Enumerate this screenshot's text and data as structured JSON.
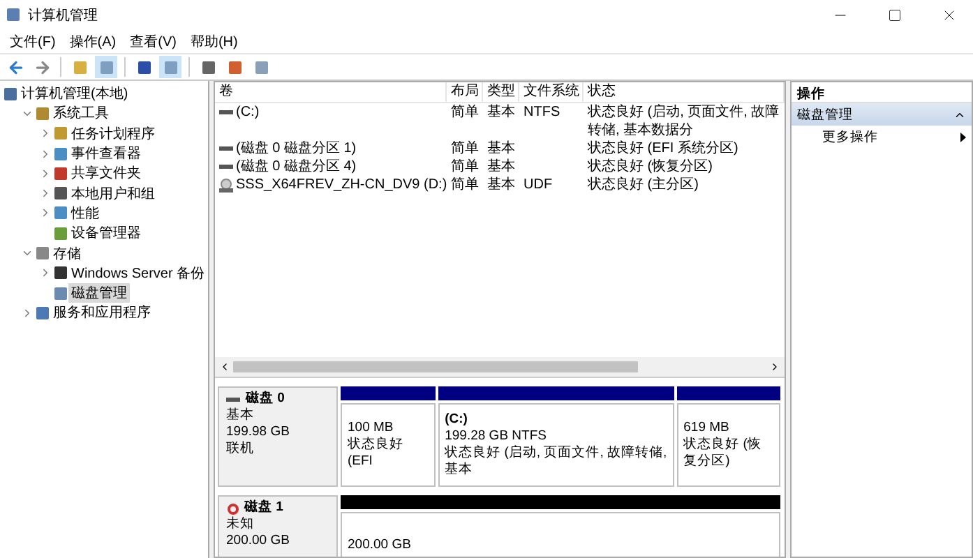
{
  "window": {
    "title": "计算机管理"
  },
  "menu": [
    "文件(F)",
    "操作(A)",
    "查看(V)",
    "帮助(H)"
  ],
  "tree": [
    {
      "label": "计算机管理(本地)",
      "selected": false,
      "children": [
        {
          "label": "系统工具",
          "selected": false,
          "expanded": true,
          "children": [
            {
              "label": "任务计划程序",
              "selected": false,
              "expanded": false
            },
            {
              "label": "事件查看器",
              "selected": false,
              "expanded": false
            },
            {
              "label": "共享文件夹",
              "selected": false,
              "expanded": false
            },
            {
              "label": "本地用户和组",
              "selected": false,
              "expanded": false
            },
            {
              "label": "性能",
              "selected": false,
              "expanded": false
            },
            {
              "label": "设备管理器",
              "selected": false
            }
          ]
        },
        {
          "label": "存储",
          "selected": false,
          "expanded": true,
          "children": [
            {
              "label": "Windows Server 备份",
              "selected": false,
              "expanded": false
            },
            {
              "label": "磁盘管理",
              "selected": true
            }
          ]
        },
        {
          "label": "服务和应用程序",
          "selected": false,
          "expanded": false
        }
      ]
    }
  ],
  "volumes": {
    "columns": [
      "卷",
      "布局",
      "类型",
      "文件系统",
      "状态"
    ],
    "rows": [
      {
        "kind": "partition",
        "cells": [
          "(C:)",
          "简单",
          "基本",
          "NTFS",
          "状态良好 (启动, 页面文件, 故障转储, 基本数据分"
        ]
      },
      {
        "kind": "partition",
        "cells": [
          "(磁盘 0 磁盘分区 1)",
          "简单",
          "基本",
          "",
          "状态良好 (EFI 系统分区)"
        ]
      },
      {
        "kind": "partition",
        "cells": [
          "(磁盘 0 磁盘分区 4)",
          "简单",
          "基本",
          "",
          "状态良好 (恢复分区)"
        ]
      },
      {
        "kind": "dvd",
        "cells": [
          "SSS_X64FREV_ZH-CN_DV9 (D:)",
          "简单",
          "基本",
          "UDF",
          "状态良好 (主分区)"
        ]
      }
    ]
  },
  "disks": [
    {
      "name": "磁盘 0",
      "kind": "online",
      "type": "基本",
      "size": "199.98 GB",
      "status": "联机",
      "partitions": [
        {
          "color": "#000080",
          "size": "100 MB",
          "status": "状态良好 (EFI"
        },
        {
          "color": "#000080",
          "label": "(C:)",
          "size": "199.28 GB NTFS",
          "status": "状态良好 (启动, 页面文件, 故障转储, 基本"
        },
        {
          "color": "#000080",
          "size": "619 MB",
          "status": "状态良好 (恢复分区)"
        }
      ]
    },
    {
      "name": "磁盘 1",
      "kind": "unknown",
      "type": "未知",
      "size": "200.00 GB",
      "partitions": [
        {
          "color": "#000000",
          "size": "200.00 GB"
        }
      ]
    }
  ],
  "actions": {
    "title": "操作",
    "section": "磁盘管理",
    "items": [
      "更多操作"
    ]
  }
}
